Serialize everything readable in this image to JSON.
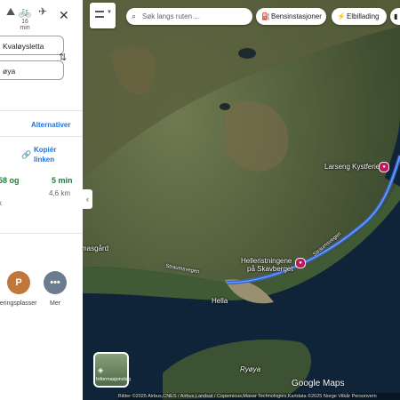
{
  "left_panel": {
    "modes": [
      {
        "icon": "walk-icon",
        "glyph": "⛰",
        "label": ""
      },
      {
        "icon": "bicycle-icon",
        "glyph": "🚲",
        "label": "16 min"
      },
      {
        "icon": "flight-icon",
        "glyph": "✈",
        "label": ""
      }
    ],
    "close_glyph": "✕",
    "origin_value": "Kvaløysletta",
    "destination_value": "øya",
    "alternatives_label": "Alternativer",
    "copy_link_label": "Kopiér linken",
    "route": {
      "via_fragment": "58 og",
      "time": "5 min",
      "distance": "4,6 km",
      "note_fragment": "k"
    },
    "nearby": [
      {
        "name": "parking",
        "glyph": "P",
        "label": "rkeringsplasser",
        "color": "#c1763a"
      },
      {
        "name": "more",
        "glyph": "•••",
        "label": "Mer",
        "color": "#6b7c8f"
      }
    ]
  },
  "map": {
    "search_placeholder": "Søk langs ruten ...",
    "chips": [
      {
        "name": "gas-stations",
        "icon": "fuel-icon",
        "glyph": "⛽",
        "label": "Bensinstasjoner"
      },
      {
        "name": "ev-charging",
        "icon": "charging-icon",
        "glyph": "⚡",
        "label": "Elbillading"
      }
    ],
    "labels": {
      "larseng": "Larseng Kystferie",
      "rockart_line1": "Helleristningene",
      "rockart_line2": "på Skavberget",
      "hella": "Hella",
      "masgard": "masgård",
      "ryoya": "Ryøya",
      "road1": "Straumsvegen",
      "road2": "Straumsvegen"
    },
    "layers_label": "Informasjonslag",
    "attribution": "Bilder ©2025 Airbus,CNES / Airbus,Landsat / Copernicus,Maxar Technologies,Kartdata ©2025     Norge     Vilkår     Personvern",
    "logo": "Google Maps",
    "route_color": "#3367d6"
  }
}
